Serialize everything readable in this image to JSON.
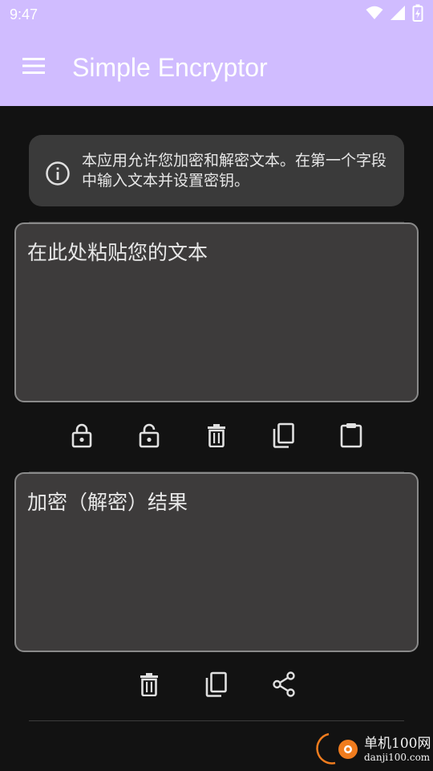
{
  "status_bar": {
    "time": "9:47",
    "icons": [
      "wifi-icon",
      "signal-icon",
      "battery-charging-icon"
    ]
  },
  "app_bar": {
    "title": "Simple Encryptor",
    "menu_icon": "hamburger-menu-icon",
    "background": "#d0bcff"
  },
  "info_card": {
    "icon": "info-icon",
    "text": "本应用允许您加密和解密文本。在第一个字段中输入文本并设置密钥。"
  },
  "input_field": {
    "placeholder": "在此处粘贴您的文本",
    "value": ""
  },
  "input_actions": [
    "lock-icon",
    "unlock-icon",
    "delete-icon",
    "copy-icon",
    "paste-icon"
  ],
  "result_field": {
    "placeholder": "加密（解密）结果",
    "value": ""
  },
  "result_actions": [
    "delete-icon",
    "copy-icon",
    "share-icon"
  ],
  "watermark": {
    "cn": "单机100网",
    "en": "danji100.com"
  },
  "colors": {
    "accent": "#d0bcff",
    "background": "#121212",
    "card": "#3a3a3a",
    "field": "#3d3b3b",
    "icon": "#e0e0e0",
    "watermark_orange": "#f07c1e"
  }
}
